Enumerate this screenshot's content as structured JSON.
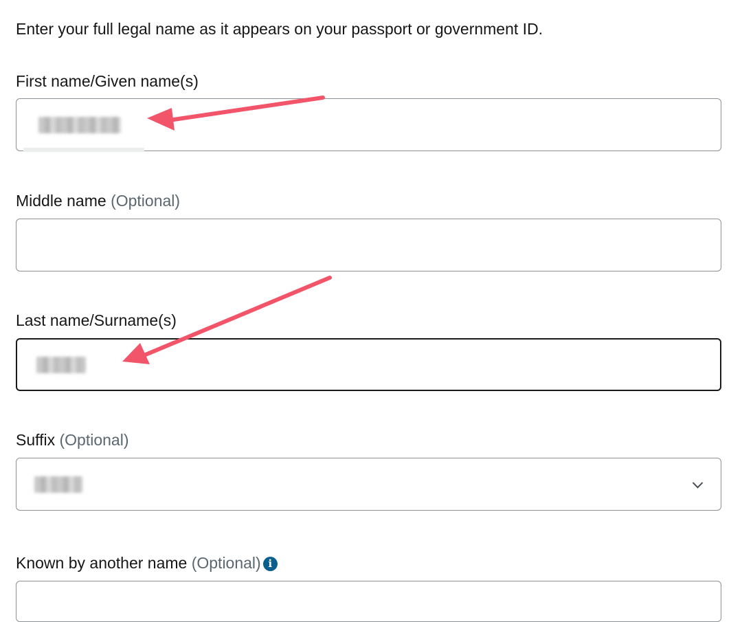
{
  "intro_text": "Enter your full legal name as it appears on your passport or government ID.",
  "first_name": {
    "label": "First name/Given name(s)"
  },
  "middle_name": {
    "label": "Middle name",
    "optional": "(Optional)"
  },
  "last_name": {
    "label": "Last name/Surname(s)"
  },
  "suffix": {
    "label": "Suffix",
    "optional": "(Optional)"
  },
  "known_by": {
    "label": "Known by another name",
    "optional": "(Optional)",
    "info_glyph": "i"
  },
  "icons": {
    "chevron": "chevron-down-icon",
    "info": "info-icon"
  },
  "colors": {
    "annotation_arrow": "#f2546a",
    "info_icon": "#0a5f8c",
    "optional_text": "#5b6770"
  }
}
